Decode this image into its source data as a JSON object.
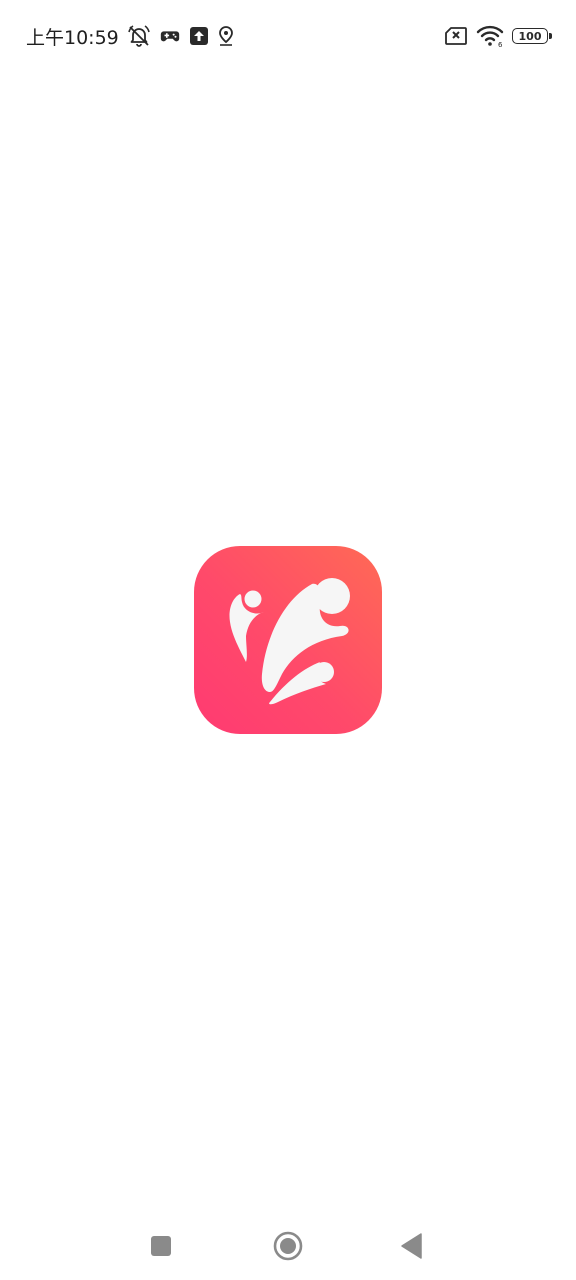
{
  "status_bar": {
    "time": "上午10:59",
    "battery_level": "100",
    "left_icons": [
      "alarm-off-icon",
      "gamepad-icon",
      "upload-icon",
      "location-icon"
    ],
    "right_icons": [
      "sim-off-icon",
      "wifi-icon",
      "battery-icon"
    ]
  },
  "splash": {
    "logo_icon": "app-logo-icon",
    "logo_gradient": [
      "#ff6a55",
      "#ff3a72"
    ]
  },
  "nav_bar": {
    "buttons": [
      "recent-apps-button",
      "home-button",
      "back-button"
    ],
    "color": "#8a8a8a"
  }
}
